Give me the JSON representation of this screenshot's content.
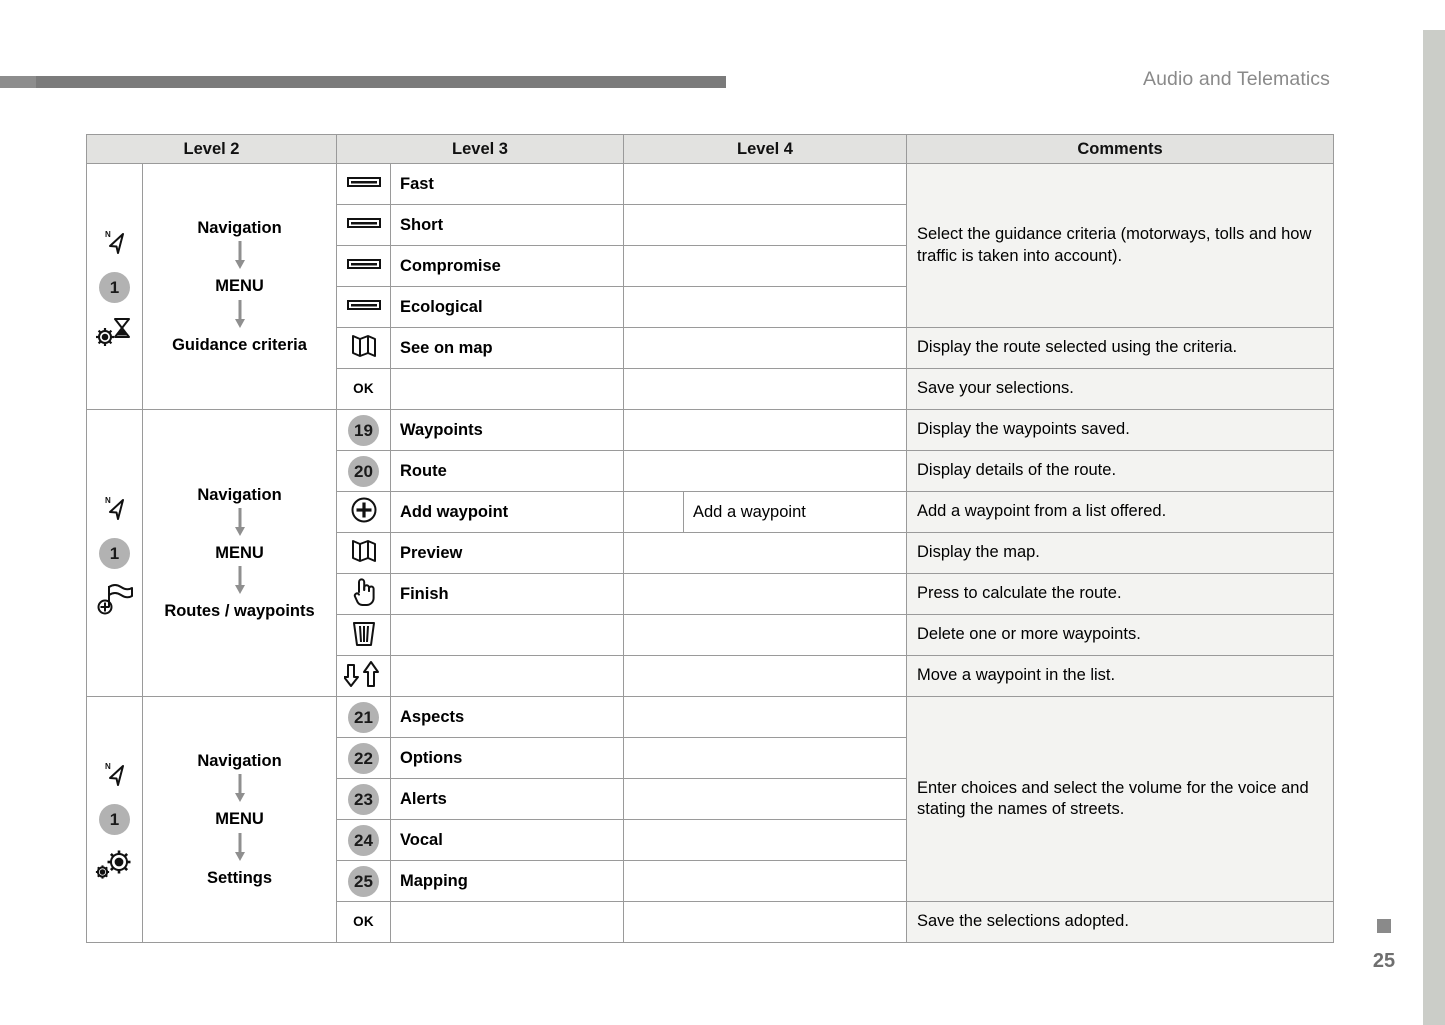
{
  "header": {
    "title": "Audio and Telematics"
  },
  "page": {
    "number": "25"
  },
  "table": {
    "columns": [
      "Level 2",
      "Level 3",
      "Level 4",
      "Comments"
    ],
    "groups": [
      {
        "id": "guidance-criteria",
        "icons": [
          "navigation-north-arrow-icon",
          "badge-1",
          "gear-hourglass-icon"
        ],
        "flow": [
          "Navigation",
          "MENU",
          "Guidance criteria"
        ],
        "rows": [
          {
            "icon": "slider-bar-icon",
            "level3": "Fast",
            "level4": "",
            "comment": "",
            "comment_span": true
          },
          {
            "icon": "slider-bar-icon",
            "level3": "Short",
            "level4": "",
            "comment": ""
          },
          {
            "icon": "slider-bar-icon",
            "level3": "Compromise",
            "level4": "",
            "comment": ""
          },
          {
            "icon": "slider-bar-icon",
            "level3": "Ecological",
            "level4": "",
            "comment": ""
          },
          {
            "icon": "map-fold-icon",
            "level3": "See on map",
            "level4": "",
            "comment": "Display the route selected using the criteria."
          },
          {
            "icon": "ok-icon",
            "level3": "",
            "level4": "",
            "comment": "Save your selections."
          }
        ],
        "merged_comment": "Select the guidance criteria (motorways, tolls and how traffic is taken into account)."
      },
      {
        "id": "routes-waypoints",
        "icons": [
          "navigation-north-arrow-icon",
          "badge-1",
          "flag-plus-icon"
        ],
        "flow": [
          "Navigation",
          "MENU",
          "Routes / waypoints"
        ],
        "rows": [
          {
            "icon": "badge-19",
            "level3": "Waypoints",
            "level4": "",
            "comment": "Display the waypoints saved."
          },
          {
            "icon": "badge-20",
            "level3": "Route",
            "level4": "",
            "comment": "Display details of the route."
          },
          {
            "icon": "plus-circle-icon",
            "level3": "Add waypoint",
            "level4": "Add a waypoint",
            "comment": "Add a waypoint from a list offered."
          },
          {
            "icon": "map-fold-icon",
            "level3": "Preview",
            "level4": "",
            "comment": "Display the map."
          },
          {
            "icon": "pointing-hand-icon",
            "level3": "Finish",
            "level4": "",
            "comment": "Press to calculate the route."
          },
          {
            "icon": "trash-bin-icon",
            "level3": "",
            "level4": "",
            "comment": "Delete one or more waypoints."
          },
          {
            "icon": "move-updown-icon",
            "level3": "",
            "level4": "",
            "comment": "Move a waypoint in the list."
          }
        ]
      },
      {
        "id": "settings",
        "icons": [
          "navigation-north-arrow-icon",
          "badge-1",
          "double-gear-icon"
        ],
        "flow": [
          "Navigation",
          "MENU",
          "Settings"
        ],
        "rows": [
          {
            "icon": "badge-21",
            "level3": "Aspects",
            "level4": "",
            "comment": "",
            "comment_span": true
          },
          {
            "icon": "badge-22",
            "level3": "Options",
            "level4": "",
            "comment": ""
          },
          {
            "icon": "badge-23",
            "level3": "Alerts",
            "level4": "",
            "comment": ""
          },
          {
            "icon": "badge-24",
            "level3": "Vocal",
            "level4": "",
            "comment": ""
          },
          {
            "icon": "badge-25",
            "level3": "Mapping",
            "level4": "",
            "comment": ""
          },
          {
            "icon": "ok-icon",
            "level3": "",
            "level4": "",
            "comment": "Save the selections adopted."
          }
        ],
        "merged_comment": "Enter choices and select the volume for the voice and stating the names of streets."
      }
    ],
    "badge_labels": {
      "b1": "1",
      "b19": "19",
      "b20": "20",
      "b21": "21",
      "b22": "22",
      "b23": "23",
      "b24": "24",
      "b25": "25"
    },
    "ok_label": "OK"
  },
  "colors": {
    "header_bar": "#7b7b7b",
    "header_text": "#8a8a8a",
    "table_header_bg": "#e2e2e0",
    "comment_bg": "#f3f3f1",
    "badge_bg": "#b2b2b2",
    "edge_strip": "#cbcdc8",
    "border": "#9a9a9a"
  }
}
